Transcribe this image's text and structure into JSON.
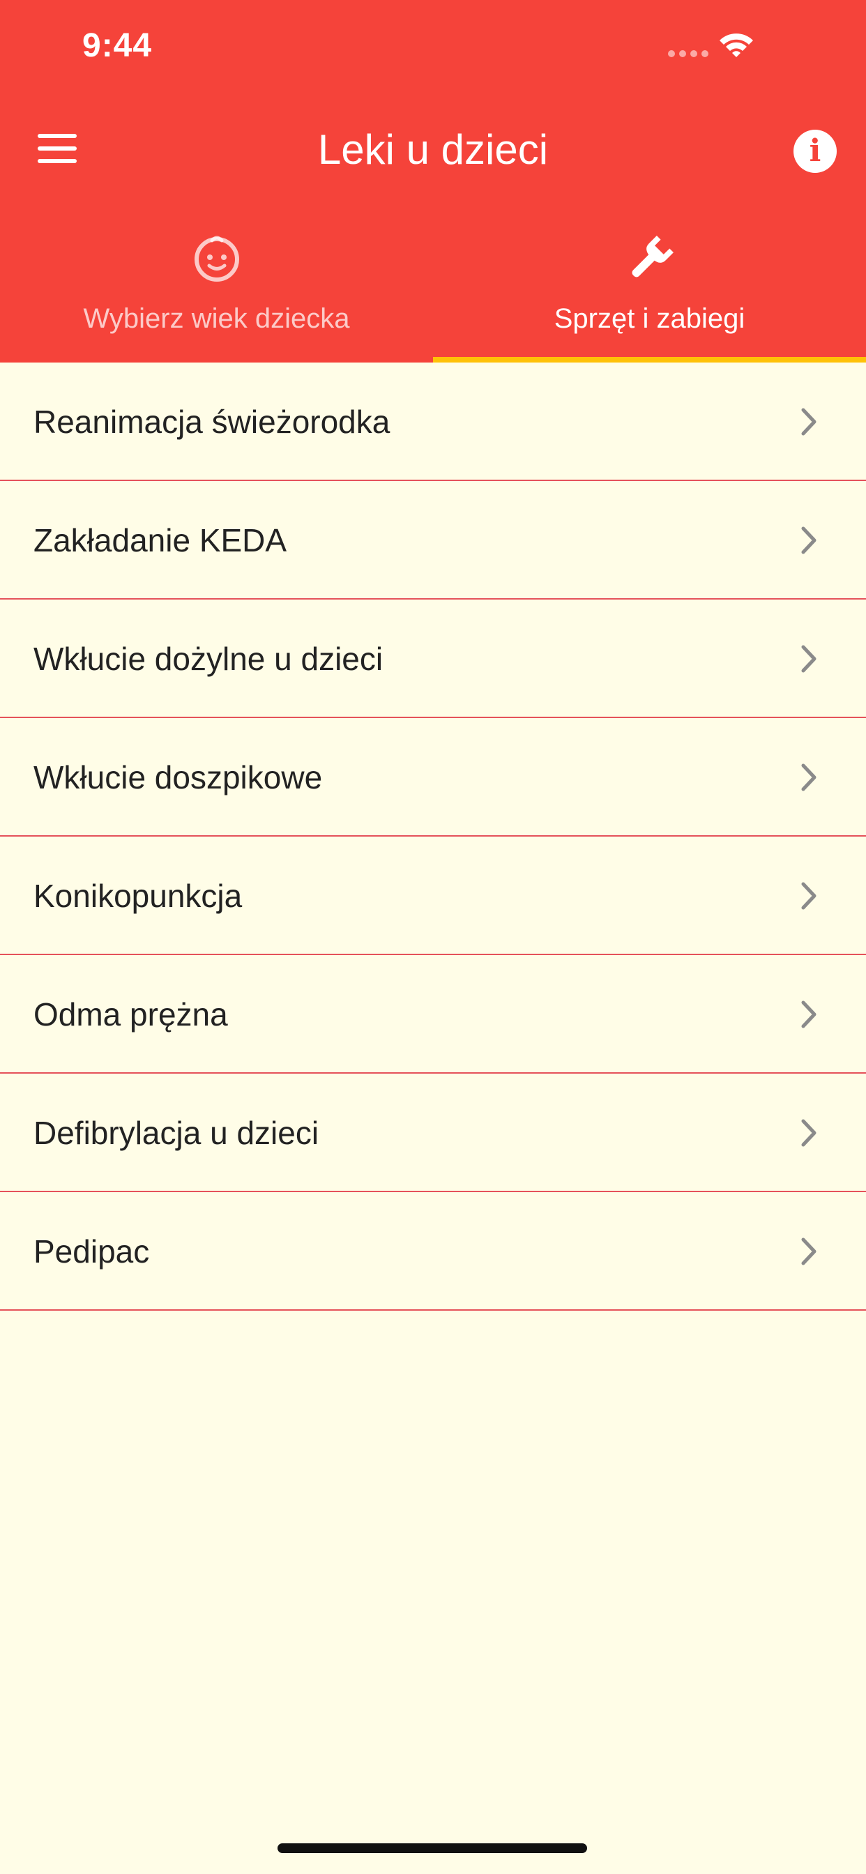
{
  "status_bar": {
    "time": "9:44",
    "icons": [
      "cellular-signal-icon",
      "wifi-icon"
    ]
  },
  "app_bar": {
    "title": "Leki u dzieci",
    "menu_icon": "menu-icon",
    "info_icon": "info-icon",
    "info_glyph": "i"
  },
  "tabs": [
    {
      "label": "Wybierz wiek dziecka",
      "icon": "baby-face-icon",
      "active": false
    },
    {
      "label": "Sprzęt i zabiegi",
      "icon": "wrench-icon",
      "active": true
    }
  ],
  "colors": {
    "primary": "#f5433a",
    "tab_indicator": "#ffc107",
    "background": "#fffde7",
    "divider": "#e5525a",
    "chevron": "#8a8a8a"
  },
  "list": {
    "chevron_icon": "chevron-right-icon",
    "items": [
      {
        "label": "Reanimacja świeżorodka"
      },
      {
        "label": "Zakładanie KEDA"
      },
      {
        "label": "Wkłucie dożylne u dzieci"
      },
      {
        "label": "Wkłucie doszpikowe"
      },
      {
        "label": "Konikopunkcja"
      },
      {
        "label": "Odma prężna"
      },
      {
        "label": "Defibrylacja u dzieci"
      },
      {
        "label": "Pedipac"
      }
    ]
  }
}
